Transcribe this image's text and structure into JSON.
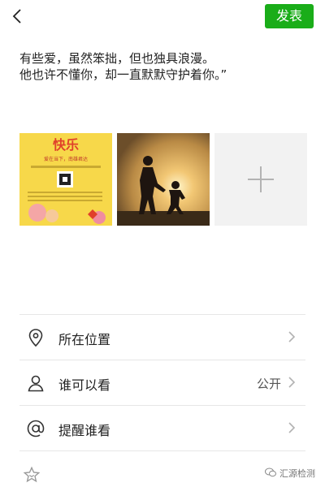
{
  "header": {
    "publish_label": "发表"
  },
  "post": {
    "text": "有些爱，虽然笨拙，但也独具浪漫。\n他也许不懂你，却一直默默守护着你。”"
  },
  "photos": {
    "poster_title": "快乐",
    "poster_subtitle": "爱在当下，南雄君达"
  },
  "options": [
    {
      "label": "所在位置",
      "value": "",
      "icon": "location-pin-icon"
    },
    {
      "label": "谁可以看",
      "value": "公开",
      "icon": "person-icon"
    },
    {
      "label": "提醒谁看",
      "value": "",
      "icon": "at-sign-icon"
    }
  ],
  "footer": {
    "watermark": "汇源检测"
  },
  "colors": {
    "accent": "#1aad19",
    "divider": "#e6e6e6",
    "add_tile_bg": "#f2f2f2"
  }
}
